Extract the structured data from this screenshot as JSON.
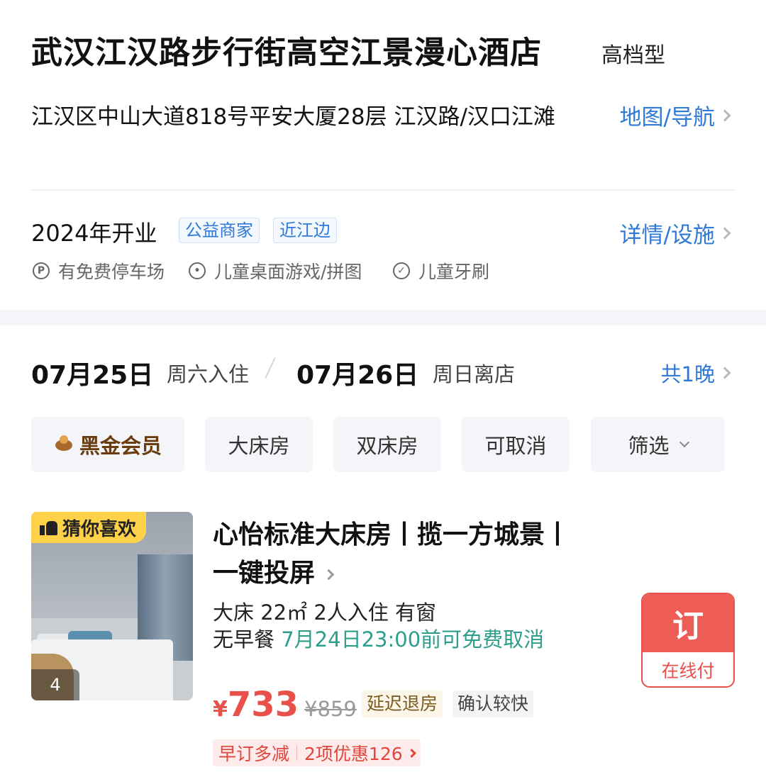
{
  "hotel": {
    "name": "武汉江汉路步行街高空江景漫心酒店",
    "grade": "高档型",
    "address": "江汉区中山大道818号平安大厦28层  江汉路/汉口江滩",
    "map_link": "地图/导航",
    "opening": "2024年开业",
    "tags": [
      "公益商家",
      "近江边"
    ],
    "detail_link": "详情/设施",
    "amenities": [
      {
        "icon": "parking-icon",
        "label": "有免费停车场"
      },
      {
        "icon": "palette-icon",
        "label": "儿童桌面游戏/拼图"
      },
      {
        "icon": "check-circle-icon",
        "label": "儿童牙刷"
      }
    ]
  },
  "stay": {
    "checkin_date": "07月25日",
    "checkin_label": "周六入住",
    "checkout_date": "07月26日",
    "checkout_label": "周日离店",
    "nights": "共1晚"
  },
  "filters": {
    "member": "黑金会员",
    "items": [
      "大床房",
      "双床房",
      "可取消"
    ],
    "more": "筛选"
  },
  "room": {
    "badge": "猜你喜欢",
    "photo_count": "4",
    "name": "心怡标准大床房丨揽一方城景丨一键投屏",
    "info": "大床 22㎡ 2人入住 有窗",
    "breakfast": "无早餐",
    "cancel_policy": "7月24日23:00前可免费取消",
    "currency": "¥",
    "price": "733",
    "original_price": "¥859",
    "tag_late_checkout": "延迟退房",
    "tag_fast_confirm": "确认较快",
    "promo_early": "早订多减",
    "promo_discount": "2项优惠126",
    "book_label": "订",
    "pay_label": "在线付"
  },
  "colors": {
    "link_blue": "#2f7ad8",
    "price_red": "#e8504a",
    "policy_green": "#2e9e8c",
    "badge_yellow": "#ffd24a"
  }
}
